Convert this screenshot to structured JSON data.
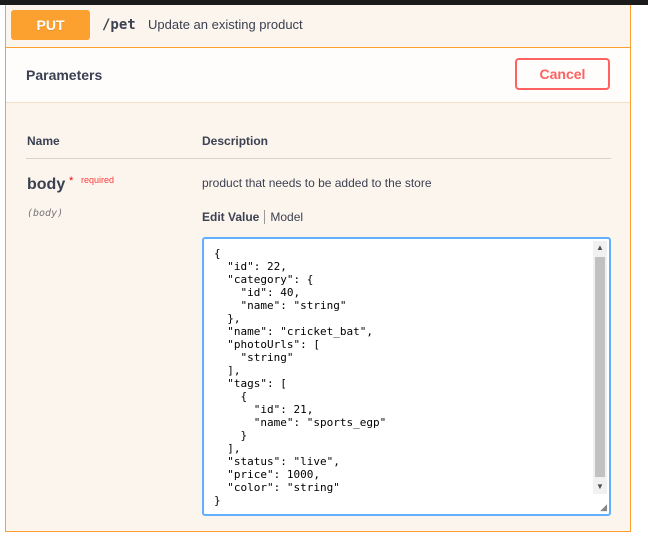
{
  "operation": {
    "method": "PUT",
    "path": "/pet",
    "summary": "Update an existing product",
    "method_color": "#fca130"
  },
  "parameters": {
    "title": "Parameters",
    "cancel_label": "Cancel",
    "col_name": "Name",
    "col_description": "Description"
  },
  "param": {
    "name": "body",
    "required_star": "*",
    "required_label": "required",
    "in": "(body)",
    "description": "product that needs to be added to the store",
    "tab_edit": "Edit Value",
    "tab_model": "Model"
  },
  "editor": {
    "lines": [
      "{",
      "  \"id\": 22,",
      "  \"category\": {",
      "    \"id\": 40,",
      "    \"name\": \"string\"",
      "  },",
      "  \"name\": \"cricket_bat\",",
      "  \"photoUrls\": [",
      "    \"string\"",
      "  ],",
      "  \"tags\": [",
      "    {",
      "      \"id\": 21,",
      "      \"name\": \"sports_egp\"",
      "    }",
      "  ],",
      "  \"status\": \"live\",",
      "  \"price\": 1000,",
      "  \"color\": \"string\"",
      "}"
    ],
    "focus_color": "#61affe"
  },
  "icons": {
    "scroll_up": "triangle-up-icon",
    "scroll_down": "triangle-down-icon",
    "resize": "resize-grip-icon"
  }
}
